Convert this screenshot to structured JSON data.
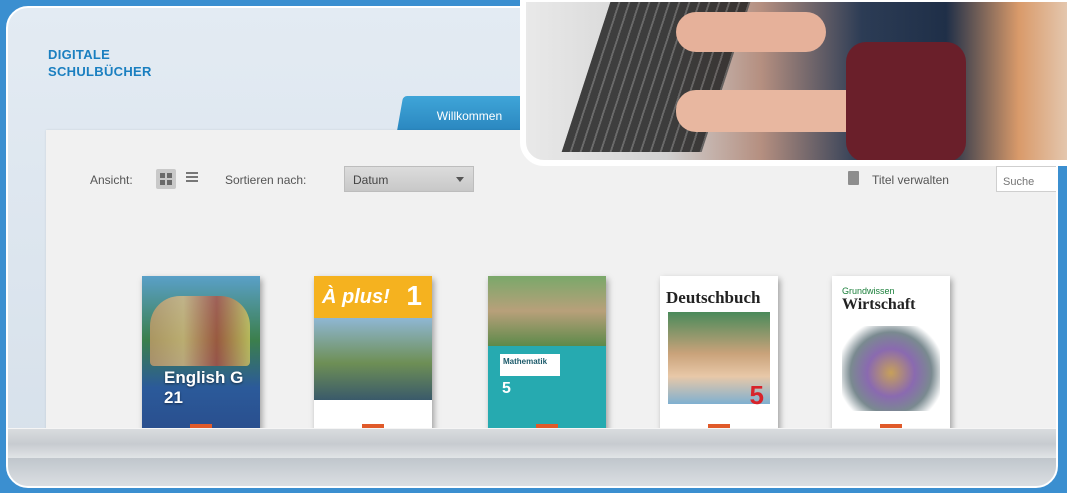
{
  "brand": {
    "line1": "DIGITALE",
    "line2": "SCHULBÜCHER"
  },
  "tab": {
    "label": "Willkommen"
  },
  "toolbar": {
    "view_label": "Ansicht:",
    "sort_label": "Sortieren nach:",
    "sort_value": "Datum",
    "manage_label": "Titel verwalten",
    "search_placeholder": "Suche"
  },
  "books": [
    {
      "title": "English G 21",
      "accent": "#2a4d8c"
    },
    {
      "title": "À plus!",
      "number": "1",
      "accent": "#f5b21f"
    },
    {
      "title": "Mathematik",
      "number": "5",
      "accent": "#26aab0"
    },
    {
      "title": "Deutschbuch",
      "number": "5",
      "accent": "#d8232a"
    },
    {
      "title": "Wirtschaft",
      "subtitle": "Grundwissen",
      "accent": "#1a7f3a"
    }
  ],
  "colors": {
    "background": "#3b8fd0",
    "brand": "#1a7fc0",
    "tab": "#2a86bf"
  }
}
